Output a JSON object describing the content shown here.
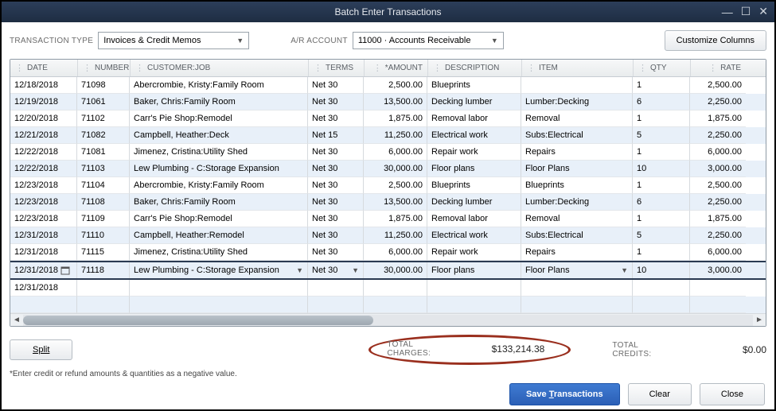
{
  "window": {
    "title": "Batch Enter Transactions"
  },
  "top": {
    "txn_type_label": "TRANSACTION TYPE",
    "txn_type_value": "Invoices & Credit Memos",
    "ar_label": "A/R ACCOUNT",
    "ar_value": "11000 · Accounts Receivable",
    "customize_btn": "Customize Columns"
  },
  "columns": {
    "date": "DATE",
    "number": "NUMBER",
    "customer": "CUSTOMER:JOB",
    "terms": "TERMS",
    "amount": "*AMOUNT",
    "desc": "DESCRIPTION",
    "item": "ITEM",
    "qty": "QTY",
    "rate": "RATE"
  },
  "rows": [
    {
      "date": "12/18/2018",
      "num": "71098",
      "cust": "Abercrombie, Kristy:Family Room",
      "terms": "Net 30",
      "amt": "2,500.00",
      "desc": "Blueprints",
      "item": "",
      "qty": "1",
      "rate": "2,500.00"
    },
    {
      "date": "12/19/2018",
      "num": "71061",
      "cust": "Baker, Chris:Family Room",
      "terms": "Net 30",
      "amt": "13,500.00",
      "desc": "Decking lumber",
      "item": "Lumber:Decking",
      "qty": "6",
      "rate": "2,250.00"
    },
    {
      "date": "12/20/2018",
      "num": "71102",
      "cust": "Carr's Pie Shop:Remodel",
      "terms": "Net 30",
      "amt": "1,875.00",
      "desc": "Removal labor",
      "item": "Removal",
      "qty": "1",
      "rate": "1,875.00"
    },
    {
      "date": "12/21/2018",
      "num": "71082",
      "cust": "Campbell, Heather:Deck",
      "terms": "Net 15",
      "amt": "11,250.00",
      "desc": "Electrical work",
      "item": "Subs:Electrical",
      "qty": "5",
      "rate": "2,250.00"
    },
    {
      "date": "12/22/2018",
      "num": "71081",
      "cust": "Jimenez, Cristina:Utility Shed",
      "terms": "Net 30",
      "amt": "6,000.00",
      "desc": "Repair work",
      "item": "Repairs",
      "qty": "1",
      "rate": "6,000.00"
    },
    {
      "date": "12/22/2018",
      "num": "71103",
      "cust": "Lew Plumbing - C:Storage Expansion",
      "terms": "Net 30",
      "amt": "30,000.00",
      "desc": "Floor plans",
      "item": "Floor Plans",
      "qty": "10",
      "rate": "3,000.00"
    },
    {
      "date": "12/23/2018",
      "num": "71104",
      "cust": "Abercrombie, Kristy:Family Room",
      "terms": "Net 30",
      "amt": "2,500.00",
      "desc": "Blueprints",
      "item": "Blueprints",
      "qty": "1",
      "rate": "2,500.00"
    },
    {
      "date": "12/23/2018",
      "num": "71108",
      "cust": "Baker, Chris:Family Room",
      "terms": "Net 30",
      "amt": "13,500.00",
      "desc": "Decking lumber",
      "item": "Lumber:Decking",
      "qty": "6",
      "rate": "2,250.00"
    },
    {
      "date": "12/23/2018",
      "num": "71109",
      "cust": "Carr's Pie Shop:Remodel",
      "terms": "Net 30",
      "amt": "1,875.00",
      "desc": "Removal labor",
      "item": "Removal",
      "qty": "1",
      "rate": "1,875.00"
    },
    {
      "date": "12/31/2018",
      "num": "71110",
      "cust": "Campbell, Heather:Remodel",
      "terms": "Net 30",
      "amt": "11,250.00",
      "desc": "Electrical work",
      "item": "Subs:Electrical",
      "qty": "5",
      "rate": "2,250.00"
    },
    {
      "date": "12/31/2018",
      "num": "71115",
      "cust": "Jimenez, Cristina:Utility Shed",
      "terms": "Net 30",
      "amt": "6,000.00",
      "desc": "Repair work",
      "item": "Repairs",
      "qty": "1",
      "rate": "6,000.00"
    }
  ],
  "selected_row": {
    "date": "12/31/2018",
    "num": "71118",
    "cust": "Lew Plumbing - C:Storage Expansion",
    "terms": "Net 30",
    "amt": "30,000.00",
    "desc": "Floor plans",
    "item": "Floor Plans",
    "qty": "10",
    "rate": "3,000.00"
  },
  "blank_row_date": "12/31/2018",
  "split_label": "Split",
  "totals": {
    "charges_label": "TOTAL CHARGES:",
    "charges_value": "$133,214.38",
    "credits_label": "TOTAL CREDITS:",
    "credits_value": "$0.00"
  },
  "hint": "*Enter credit or refund amounts & quantities as a negative value.",
  "footer": {
    "save": "Save Transactions",
    "clear": "Clear",
    "close": "Close"
  }
}
